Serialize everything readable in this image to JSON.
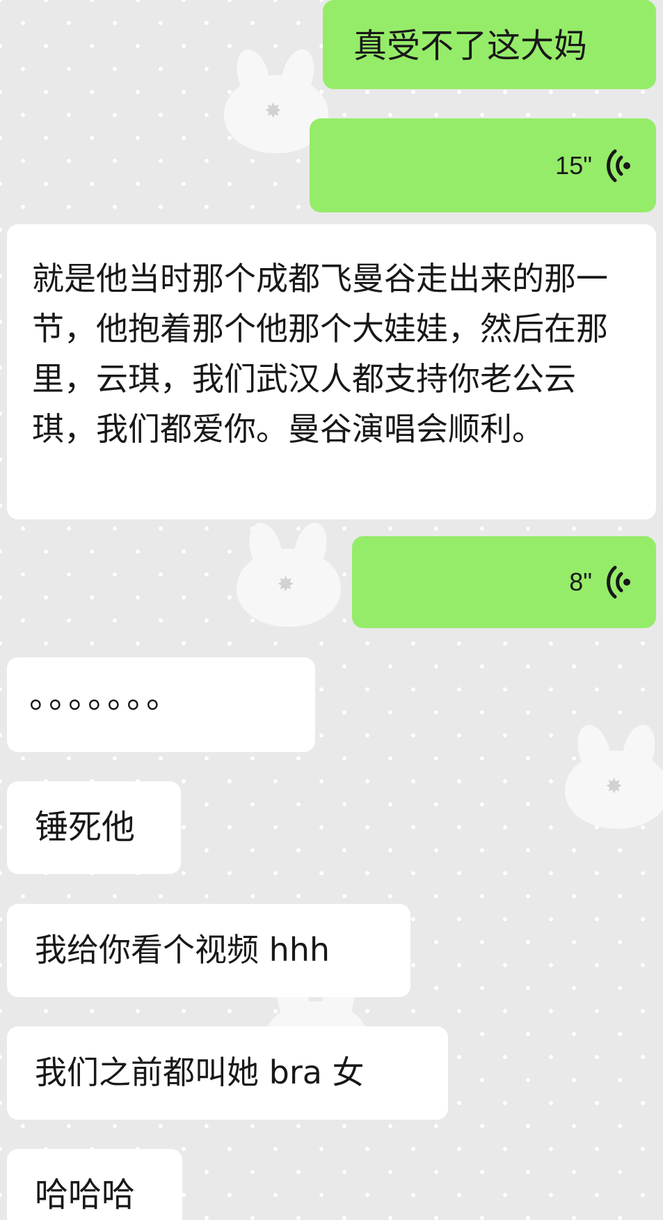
{
  "messages": [
    {
      "side": "out",
      "kind": "text",
      "text": "真受不了这大妈"
    },
    {
      "side": "out",
      "kind": "voice",
      "duration": "15\""
    },
    {
      "side": "in",
      "kind": "text",
      "text": "就是他当时那个成都飞曼谷走出来的那一节，他抱着那个他那个大娃娃，然后在那里，云琪，我们武汉人都支持你老公云琪，我们都爱你。曼谷演唱会顺利。"
    },
    {
      "side": "out",
      "kind": "voice",
      "duration": "8\""
    },
    {
      "side": "in",
      "kind": "text",
      "text": "。。。。。。。"
    },
    {
      "side": "in",
      "kind": "text",
      "text": "锤死他"
    },
    {
      "side": "in",
      "kind": "text",
      "text": "我给你看个视频 hhh"
    },
    {
      "side": "in",
      "kind": "text",
      "text": "我们之前都叫她 bra 女"
    },
    {
      "side": "in",
      "kind": "text",
      "text": "哈哈哈"
    }
  ],
  "icons": {
    "voice": "voice-wave-icon",
    "wallpaper": "bunny-icon"
  },
  "colors": {
    "outgoing_bubble": "#95ec69",
    "incoming_bubble": "#ffffff",
    "background": "#e9e9e9",
    "voice_icon": "#181818"
  }
}
